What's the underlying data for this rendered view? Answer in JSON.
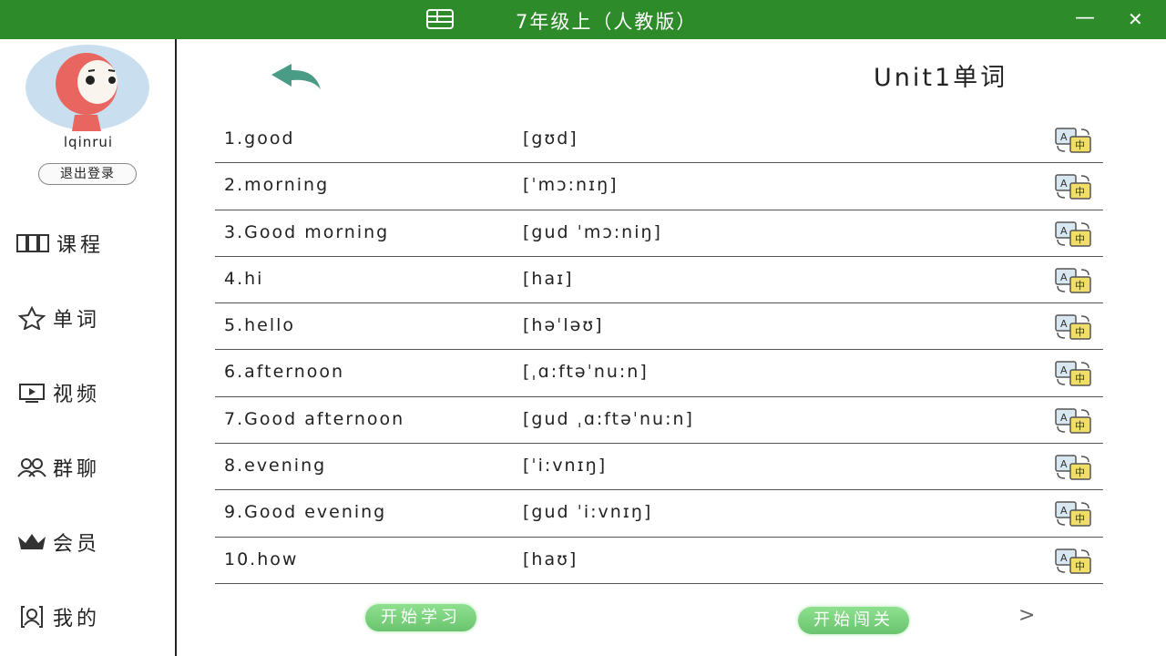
{
  "window": {
    "title": "7年级上（人教版）",
    "minimize": "—",
    "close": "✕"
  },
  "user": {
    "name": "lqinrui",
    "logout_label": "退出登录"
  },
  "nav": [
    {
      "label": "课程",
      "icon": "book-icon"
    },
    {
      "label": "单词",
      "icon": "star-icon"
    },
    {
      "label": "视频",
      "icon": "video-icon"
    },
    {
      "label": "群聊",
      "icon": "group-icon"
    },
    {
      "label": "会员",
      "icon": "crown-icon"
    },
    {
      "label": "我的",
      "icon": "profile-icon"
    }
  ],
  "unit_title": "Unit1单词",
  "words": [
    {
      "label": "1.good",
      "phonetic": "[gʊd]"
    },
    {
      "label": "2.morning",
      "phonetic": "[ˈmɔ:nɪŋ]"
    },
    {
      "label": "3.Good morning",
      "phonetic": "[gud ˈmɔ:niŋ]"
    },
    {
      "label": "4.hi",
      "phonetic": "[haɪ]"
    },
    {
      "label": "5.hello",
      "phonetic": "[həˈləʊ]"
    },
    {
      "label": "6.afternoon",
      "phonetic": "[ˌɑ:ftəˈnu:n]"
    },
    {
      "label": "7.Good afternoon",
      "phonetic": "[gud ˌɑ:ftəˈnu:n]"
    },
    {
      "label": "8.evening",
      "phonetic": "[ˈi:vnɪŋ]"
    },
    {
      "label": "9.Good evening",
      "phonetic": "[gud ˈi:vnɪŋ]"
    },
    {
      "label": "10.how",
      "phonetic": "[haʊ]"
    }
  ],
  "buttons": {
    "start_learning": "开始学习",
    "start_challenge": "开始闯关",
    "next": ">"
  },
  "colors": {
    "titlebar": "#2e8b2a",
    "accent_green": "#6ac46e",
    "back_arrow": "#4a9c86"
  }
}
